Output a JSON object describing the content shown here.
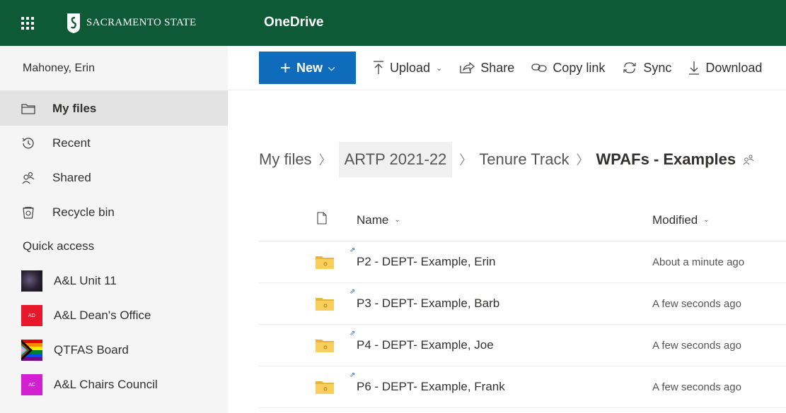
{
  "header": {
    "org_name": "SACRAMENTO STATE",
    "app_name": "OneDrive"
  },
  "sidebar": {
    "user_name": "Mahoney, Erin",
    "nav": [
      {
        "label": "My files",
        "icon": "folder-icon"
      },
      {
        "label": "Recent",
        "icon": "clock-icon"
      },
      {
        "label": "Shared",
        "icon": "people-icon"
      },
      {
        "label": "Recycle bin",
        "icon": "trash-icon"
      }
    ],
    "quick_access_title": "Quick access",
    "quick_access": [
      {
        "label": "A&L Unit 11",
        "thumb": "",
        "color": "#2a2233"
      },
      {
        "label": "A&L Dean's Office",
        "thumb": "AD",
        "color": "#e8182c"
      },
      {
        "label": "QTFAS Board",
        "thumb": "",
        "color": "pride"
      },
      {
        "label": "A&L Chairs Council",
        "thumb": "AC",
        "color": "#d21fcf"
      }
    ]
  },
  "commands": {
    "new_label": "New",
    "upload_label": "Upload",
    "share_label": "Share",
    "copy_link_label": "Copy link",
    "sync_label": "Sync",
    "download_label": "Download"
  },
  "breadcrumb": {
    "items": [
      "My files",
      "ARTP 2021-22",
      "Tenure Track",
      "WPAFs - Examples"
    ]
  },
  "list": {
    "name_header": "Name",
    "modified_header": "Modified",
    "rows": [
      {
        "name": "P2 - DEPT- Example, Erin",
        "modified": "About a minute ago"
      },
      {
        "name": "P3 - DEPT- Example, Barb",
        "modified": "A few seconds ago"
      },
      {
        "name": "P4 - DEPT- Example, Joe",
        "modified": "A few seconds ago"
      },
      {
        "name": "P6 - DEPT- Example, Frank",
        "modified": "A few seconds ago"
      }
    ]
  },
  "colors": {
    "brand_green": "#0f5a36",
    "primary_blue": "#0f6cbd",
    "folder_yellow": "#f6c74a"
  }
}
